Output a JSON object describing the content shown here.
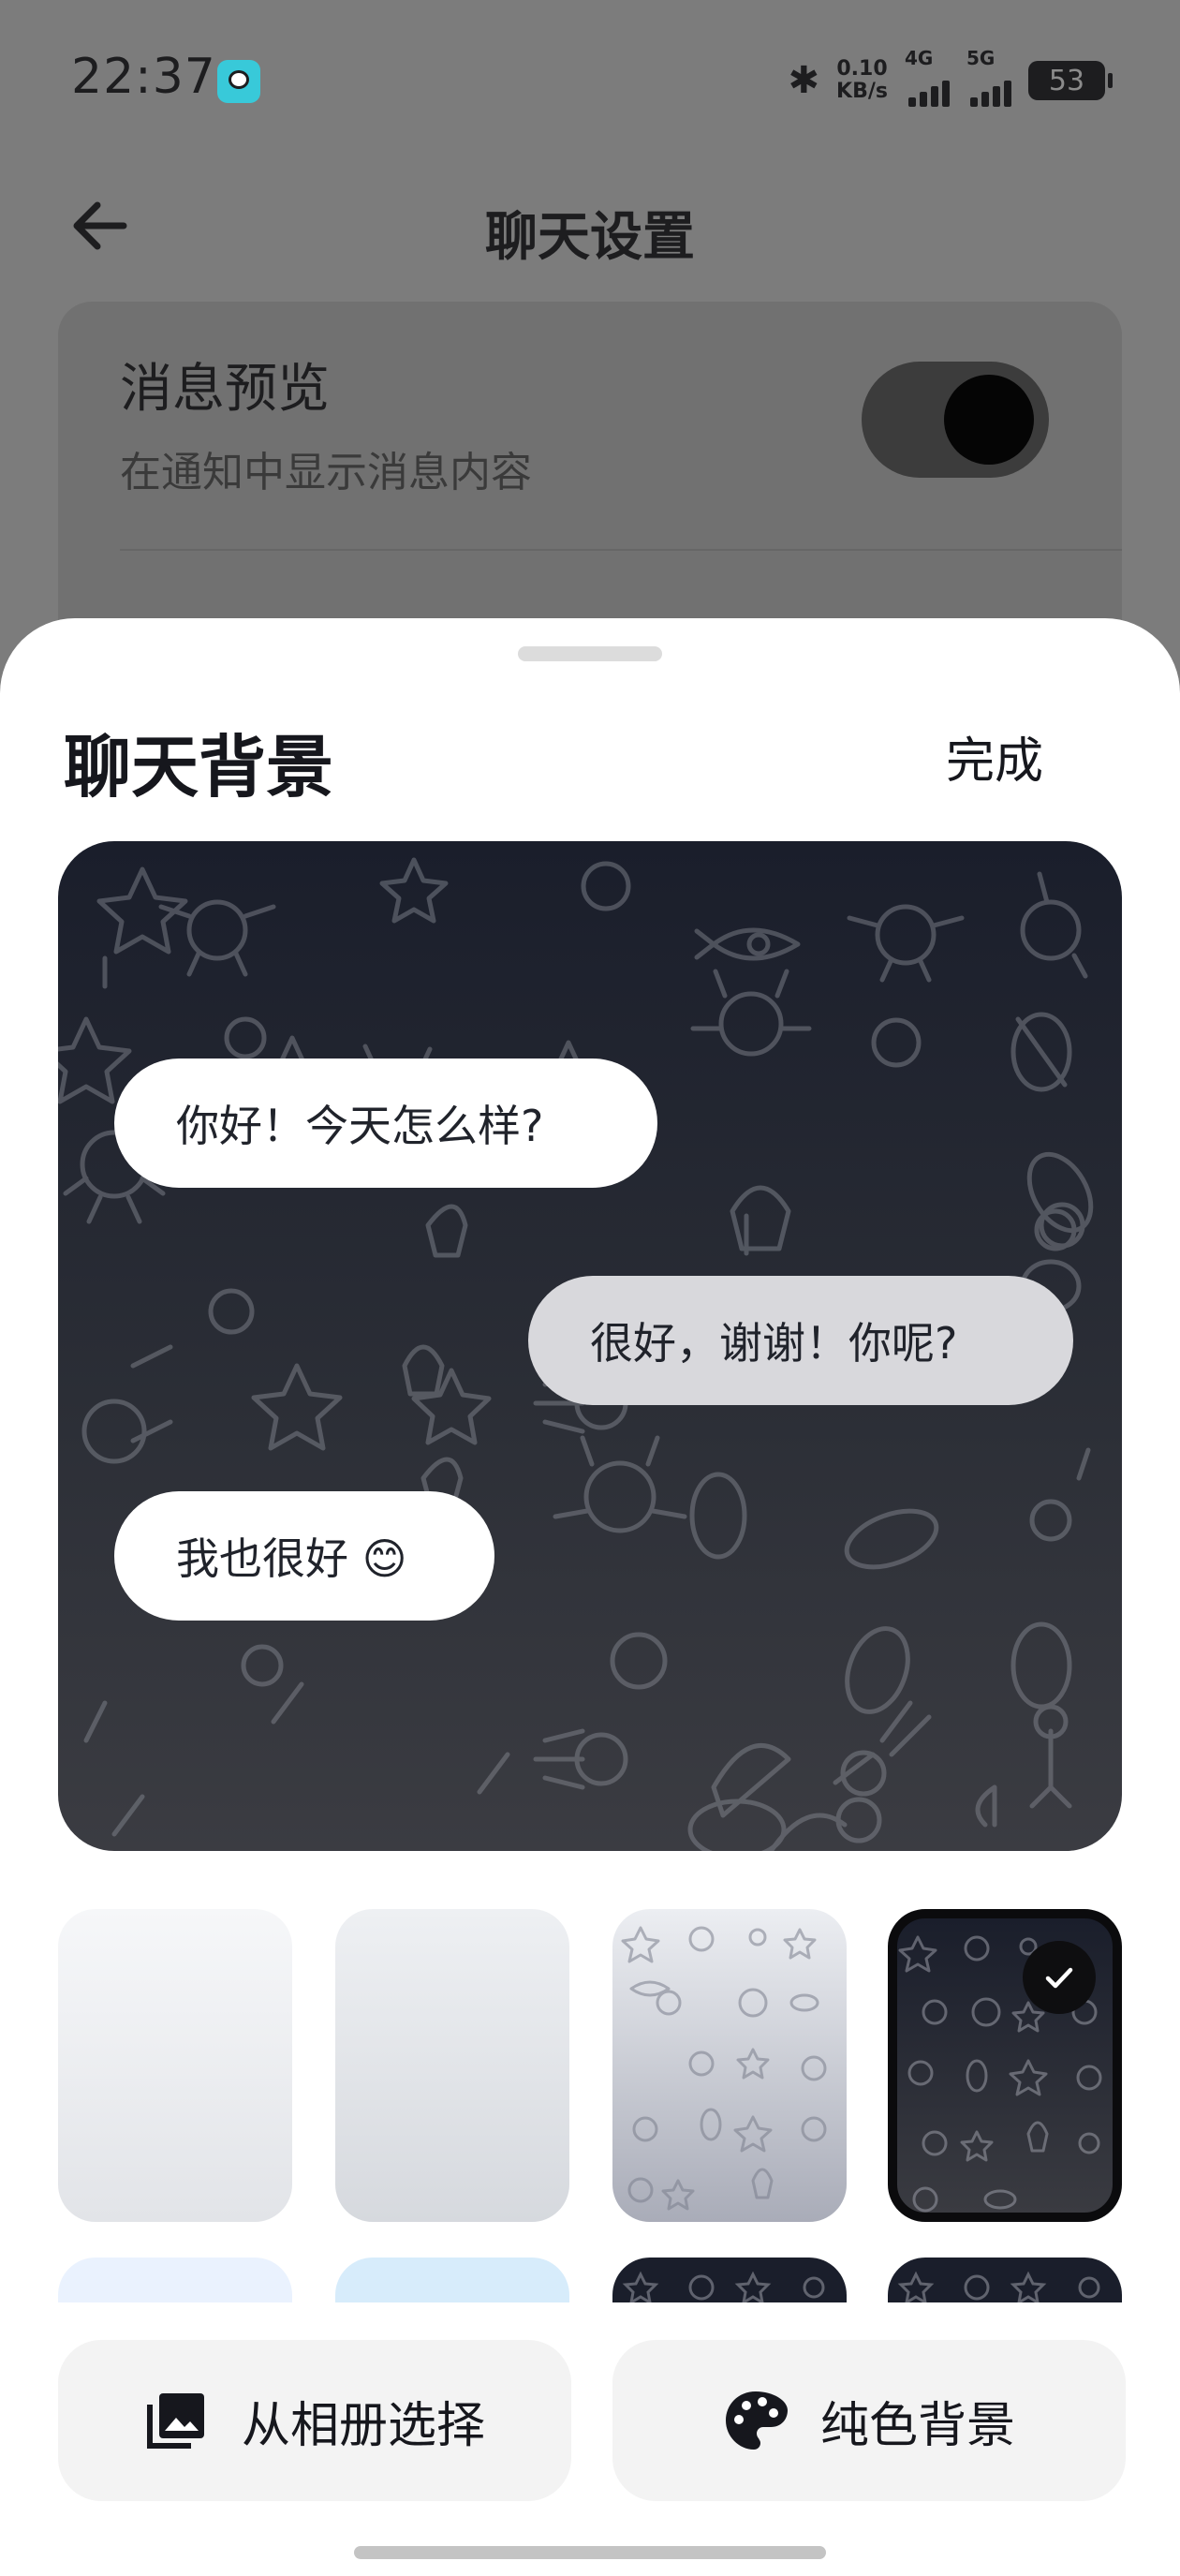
{
  "status_bar": {
    "time": "22:37",
    "net_speed_value": "0.10",
    "net_speed_unit": "KB/s",
    "signal_1_label": "4G",
    "signal_2_label": "5G",
    "battery_level": "53"
  },
  "nav": {
    "title": "聊天设置",
    "back_icon": "arrow-left-icon"
  },
  "settings": {
    "message_preview_title": "消息预览",
    "message_preview_subtitle": "在通知中显示消息内容",
    "message_preview_enabled": true
  },
  "sheet": {
    "title": "聊天背景",
    "done_label": "完成",
    "preview_messages": [
      {
        "text": "你好！今天怎么样?",
        "side": "incoming"
      },
      {
        "text": "很好，谢谢！你呢?",
        "side": "outgoing"
      },
      {
        "text": "我也很好 😊",
        "side": "incoming"
      }
    ],
    "backgrounds": [
      {
        "style": "plain-light",
        "selected": false
      },
      {
        "style": "plain-grey",
        "selected": false
      },
      {
        "style": "doodle-light",
        "selected": false
      },
      {
        "style": "doodle-dark",
        "selected": true
      }
    ],
    "background_colors": {
      "preview_top": "#1a1e2b",
      "preview_bottom": "#3b3c42",
      "accent": "#16171d"
    },
    "actions": {
      "album_label": "从相册选择",
      "album_icon": "photo-album-icon",
      "solid_label": "纯色背景",
      "solid_icon": "palette-icon"
    }
  }
}
